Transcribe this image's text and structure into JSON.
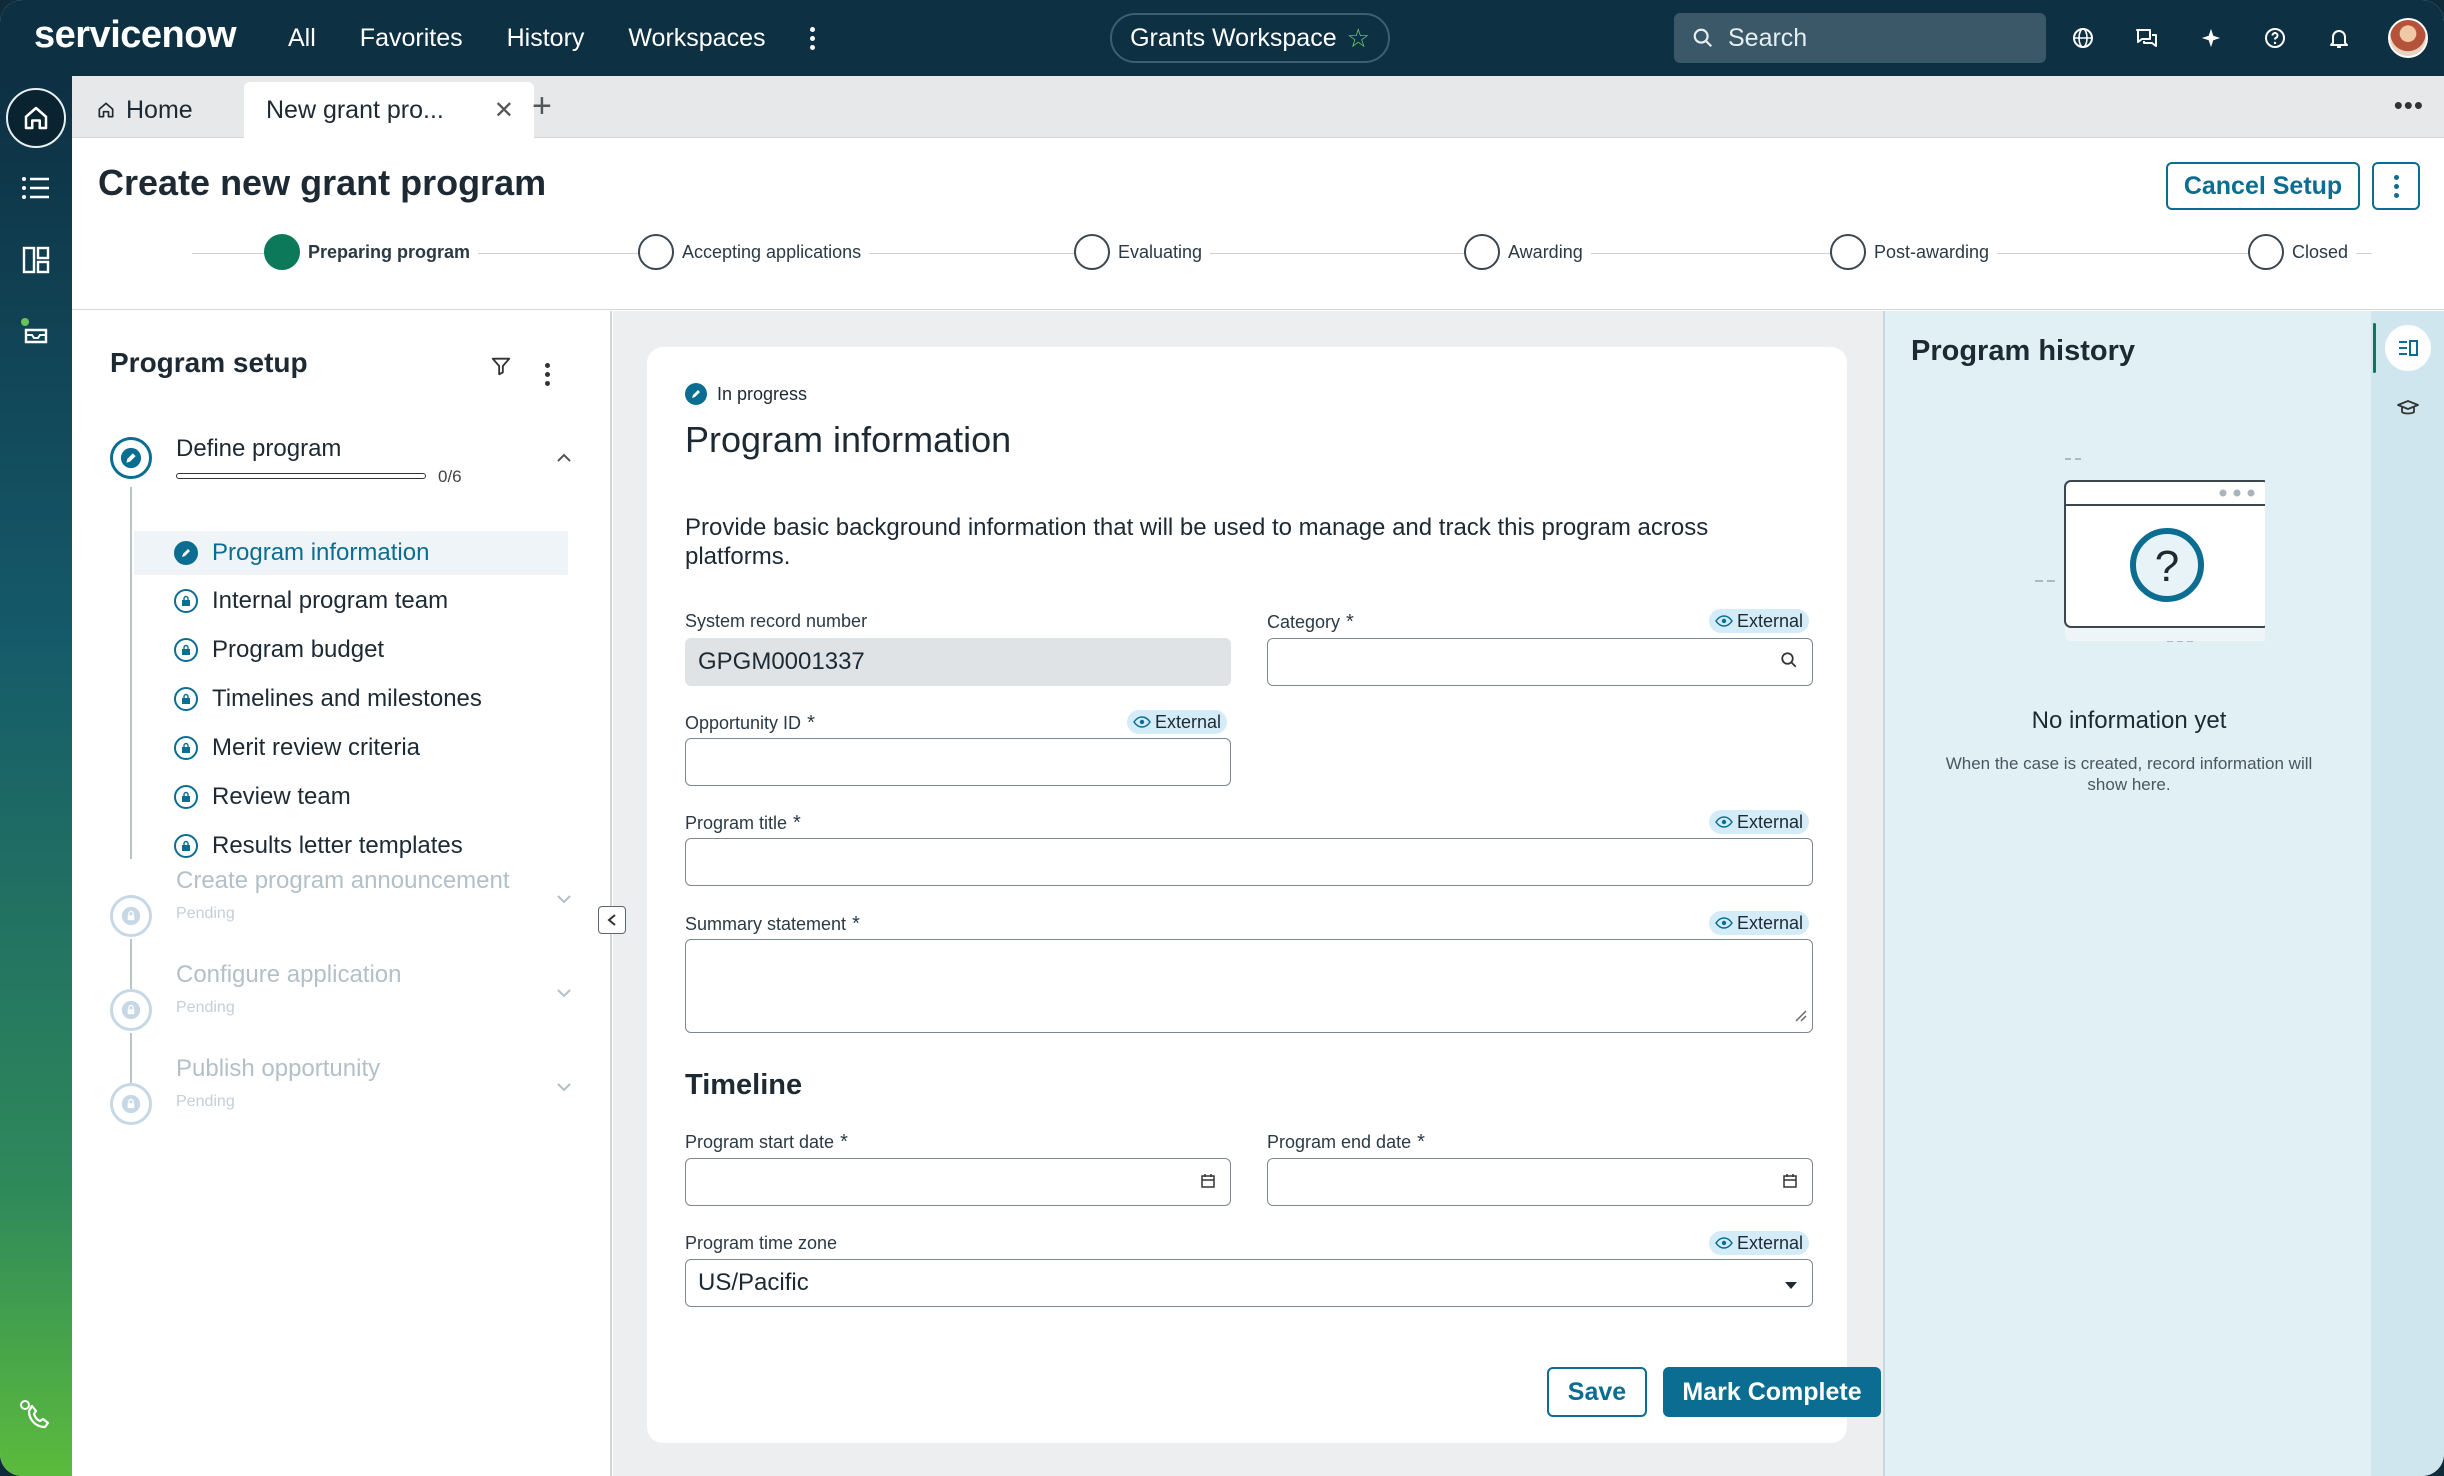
{
  "app": {
    "logo": "servicenow"
  },
  "topnav": {
    "items": [
      "All",
      "Favorites",
      "History",
      "Workspaces"
    ]
  },
  "workspace": {
    "label": "Grants Workspace"
  },
  "search": {
    "placeholder": "Search"
  },
  "tabs": {
    "home": "Home",
    "active": "New grant pro..."
  },
  "header": {
    "title": "Create new grant program",
    "cancel_label": "Cancel Setup"
  },
  "stepper": {
    "steps": [
      "Preparing program",
      "Accepting applications",
      "Evaluating",
      "Awarding",
      "Post-awarding",
      "Closed"
    ],
    "current": "Preparing program"
  },
  "program_setup": {
    "title": "Program setup",
    "group_define": {
      "title": "Define program",
      "progress_text": "0/6",
      "progress": 0
    },
    "sub_items": [
      "Program information",
      "Internal program team",
      "Program budget",
      "Timelines and milestones",
      "Merit review criteria",
      "Review team",
      "Results letter templates"
    ],
    "pending_groups": [
      {
        "title": "Create program announcement",
        "status": "Pending"
      },
      {
        "title": "Configure application",
        "status": "Pending"
      },
      {
        "title": "Publish opportunity",
        "status": "Pending"
      }
    ]
  },
  "form": {
    "status": "In progress",
    "title": "Program information",
    "description": "Provide basic background information that will be used to manage and track this program across platforms.",
    "external_tag": "External",
    "system_record_label": "System record number",
    "system_record_value": "GPGM0001337",
    "category_label": "Category",
    "opportunity_label": "Opportunity ID",
    "program_title_label": "Program title",
    "summary_label": "Summary statement",
    "timeline_heading": "Timeline",
    "start_label": "Program start date",
    "end_label": "Program end date",
    "timezone_label": "Program time zone",
    "timezone_value": "US/Pacific",
    "save_label": "Save",
    "complete_label": "Mark Complete",
    "required_mark": "*"
  },
  "history": {
    "title": "Program history",
    "empty_title": "No information yet",
    "empty_hint": "When the case is created, record information will show here."
  },
  "colors": {
    "brand": "#0d3043",
    "accent": "#0a6d91",
    "success": "#0c7a5a",
    "history_bg": "#e1f0f5"
  }
}
